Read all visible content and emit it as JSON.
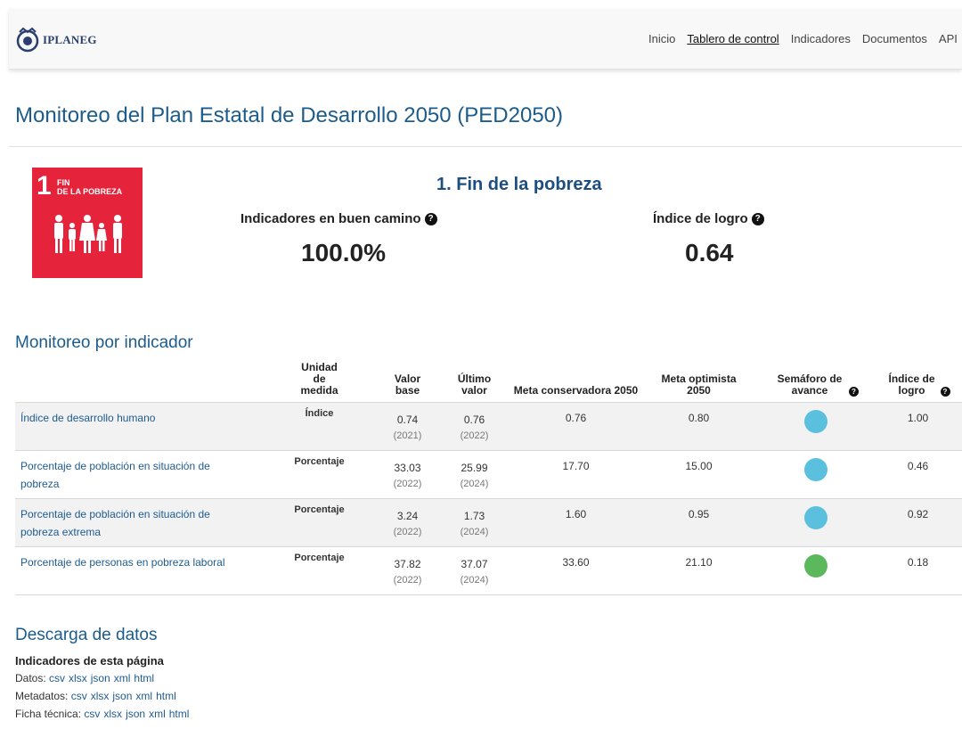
{
  "header": {
    "logo_text": "IPLANEG",
    "nav": [
      "Inicio",
      "Tablero de control",
      "Indicadores",
      "Documentos",
      "API"
    ],
    "active_nav": "Tablero de control"
  },
  "page_title": "Monitoreo del Plan Estatal de Desarrollo 2050 (PED2050)",
  "goal": {
    "tile": {
      "number": "1",
      "label_line1": "FIN",
      "label_line2": "DE LA POBREZA",
      "color": "#e5243b"
    },
    "title": "1. Fin de la pobreza",
    "kpis": [
      {
        "label": "Indicadores en buen camino",
        "value": "100.0%"
      },
      {
        "label": "Índice de logro",
        "value": "0.64"
      }
    ]
  },
  "monitoring": {
    "title": "Monitoreo por indicador",
    "columns": [
      "",
      "Unidad de medida",
      "Valor base",
      "Último valor",
      "Meta conservadora 2050",
      "Meta optimista 2050",
      "Semáforo de avance",
      "Índice de logro"
    ],
    "rows": [
      {
        "indicator": "Índice de desarrollo humano",
        "unit": "Índice",
        "base": "0.74",
        "base_year": "(2021)",
        "last": "0.76",
        "last_year": "(2022)",
        "meta_cons": "0.76",
        "meta_opt": "0.80",
        "light": "#5bc0de",
        "index": "1.00"
      },
      {
        "indicator": "Porcentaje de población en situación de pobreza",
        "unit": "Porcentaje",
        "base": "33.03",
        "base_year": "(2022)",
        "last": "25.99",
        "last_year": "(2024)",
        "meta_cons": "17.70",
        "meta_opt": "15.00",
        "light": "#5bc0de",
        "index": "0.46"
      },
      {
        "indicator": "Porcentaje de población en situación de pobreza extrema",
        "unit": "Porcentaje",
        "base": "3.24",
        "base_year": "(2022)",
        "last": "1.73",
        "last_year": "(2024)",
        "meta_cons": "1.60",
        "meta_opt": "0.95",
        "light": "#5bc0de",
        "index": "0.92"
      },
      {
        "indicator": "Porcentaje de personas en pobreza laboral",
        "unit": "Porcentaje",
        "base": "37.82",
        "base_year": "(2022)",
        "last": "37.07",
        "last_year": "(2024)",
        "meta_cons": "33.60",
        "meta_opt": "21.10",
        "light": "#5cb85c",
        "index": "0.18"
      }
    ]
  },
  "downloads": {
    "title": "Descarga de datos",
    "subtitle": "Indicadores de esta página",
    "lines": [
      {
        "label": "Datos:",
        "formats": [
          "csv",
          "xlsx",
          "json",
          "xml",
          "html"
        ]
      },
      {
        "label": "Metadatos:",
        "formats": [
          "csv",
          "xlsx",
          "json",
          "xml",
          "html"
        ]
      },
      {
        "label": "Ficha técnica:",
        "formats": [
          "csv",
          "xlsx",
          "json",
          "xml",
          "html"
        ]
      }
    ]
  }
}
